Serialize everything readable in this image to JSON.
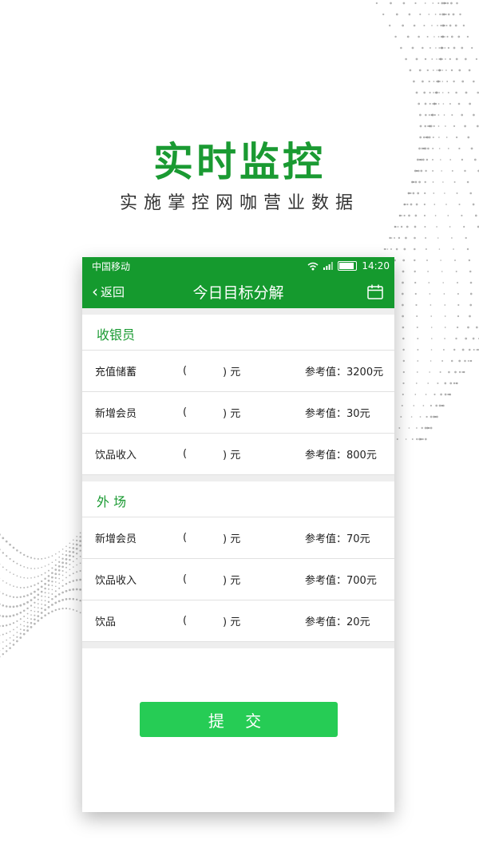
{
  "promo": {
    "title": "实时监控",
    "subtitle": "实施掌控网咖营业数据"
  },
  "statusbar": {
    "carrier": "中国移动",
    "time": "14:20"
  },
  "navbar": {
    "back_label": "返回",
    "title": "今日目标分解"
  },
  "sections": [
    {
      "title": "收银员",
      "rows": [
        {
          "label": "充值储蓄",
          "paren_left": "(",
          "paren_right": ")",
          "unit": "元",
          "reference": "参考值：3200元"
        },
        {
          "label": "新增会员",
          "paren_left": "(",
          "paren_right": ")",
          "unit": "元",
          "reference": "参考值：30元"
        },
        {
          "label": "饮品收入",
          "paren_left": "(",
          "paren_right": ")",
          "unit": "元",
          "reference": "参考值：800元"
        }
      ]
    },
    {
      "title": "外 场",
      "rows": [
        {
          "label": "新增会员",
          "paren_left": "(",
          "paren_right": ")",
          "unit": "元",
          "reference": "参考值：70元"
        },
        {
          "label": "饮品收入",
          "paren_left": "(",
          "paren_right": ")",
          "unit": "元",
          "reference": "参考值：700元"
        },
        {
          "label": "饮品",
          "paren_left": "(",
          "paren_right": ")",
          "unit": "元",
          "reference": "参考值：20元"
        }
      ]
    }
  ],
  "submit_label": "提 交",
  "colors": {
    "brand_green": "#159a2e",
    "title_green": "#1a9a32",
    "button_green": "#26cc55"
  },
  "icons": [
    "wifi-icon",
    "signal-icon",
    "battery-icon",
    "chevron-left-icon",
    "calendar-icon"
  ]
}
